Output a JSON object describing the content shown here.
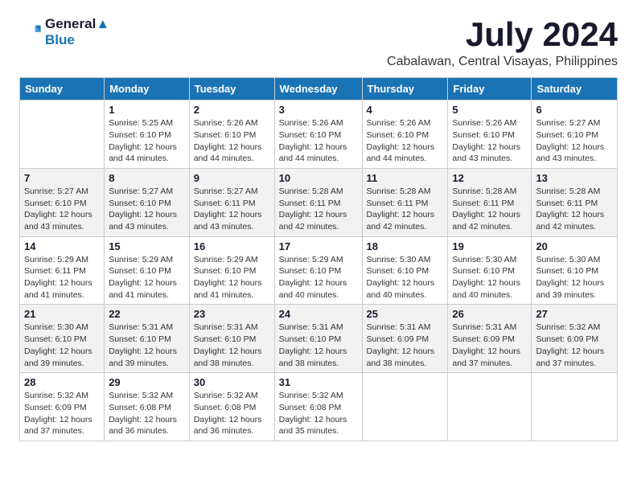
{
  "logo": {
    "line1": "General",
    "line2": "Blue"
  },
  "title": {
    "month_year": "July 2024",
    "location": "Cabalawan, Central Visayas, Philippines"
  },
  "headers": [
    "Sunday",
    "Monday",
    "Tuesday",
    "Wednesday",
    "Thursday",
    "Friday",
    "Saturday"
  ],
  "weeks": [
    [
      {
        "day": "",
        "info": ""
      },
      {
        "day": "1",
        "info": "Sunrise: 5:25 AM\nSunset: 6:10 PM\nDaylight: 12 hours\nand 44 minutes."
      },
      {
        "day": "2",
        "info": "Sunrise: 5:26 AM\nSunset: 6:10 PM\nDaylight: 12 hours\nand 44 minutes."
      },
      {
        "day": "3",
        "info": "Sunrise: 5:26 AM\nSunset: 6:10 PM\nDaylight: 12 hours\nand 44 minutes."
      },
      {
        "day": "4",
        "info": "Sunrise: 5:26 AM\nSunset: 6:10 PM\nDaylight: 12 hours\nand 44 minutes."
      },
      {
        "day": "5",
        "info": "Sunrise: 5:26 AM\nSunset: 6:10 PM\nDaylight: 12 hours\nand 43 minutes."
      },
      {
        "day": "6",
        "info": "Sunrise: 5:27 AM\nSunset: 6:10 PM\nDaylight: 12 hours\nand 43 minutes."
      }
    ],
    [
      {
        "day": "7",
        "info": "Sunrise: 5:27 AM\nSunset: 6:10 PM\nDaylight: 12 hours\nand 43 minutes."
      },
      {
        "day": "8",
        "info": "Sunrise: 5:27 AM\nSunset: 6:10 PM\nDaylight: 12 hours\nand 43 minutes."
      },
      {
        "day": "9",
        "info": "Sunrise: 5:27 AM\nSunset: 6:11 PM\nDaylight: 12 hours\nand 43 minutes."
      },
      {
        "day": "10",
        "info": "Sunrise: 5:28 AM\nSunset: 6:11 PM\nDaylight: 12 hours\nand 42 minutes."
      },
      {
        "day": "11",
        "info": "Sunrise: 5:28 AM\nSunset: 6:11 PM\nDaylight: 12 hours\nand 42 minutes."
      },
      {
        "day": "12",
        "info": "Sunrise: 5:28 AM\nSunset: 6:11 PM\nDaylight: 12 hours\nand 42 minutes."
      },
      {
        "day": "13",
        "info": "Sunrise: 5:28 AM\nSunset: 6:11 PM\nDaylight: 12 hours\nand 42 minutes."
      }
    ],
    [
      {
        "day": "14",
        "info": "Sunrise: 5:29 AM\nSunset: 6:11 PM\nDaylight: 12 hours\nand 41 minutes."
      },
      {
        "day": "15",
        "info": "Sunrise: 5:29 AM\nSunset: 6:10 PM\nDaylight: 12 hours\nand 41 minutes."
      },
      {
        "day": "16",
        "info": "Sunrise: 5:29 AM\nSunset: 6:10 PM\nDaylight: 12 hours\nand 41 minutes."
      },
      {
        "day": "17",
        "info": "Sunrise: 5:29 AM\nSunset: 6:10 PM\nDaylight: 12 hours\nand 40 minutes."
      },
      {
        "day": "18",
        "info": "Sunrise: 5:30 AM\nSunset: 6:10 PM\nDaylight: 12 hours\nand 40 minutes."
      },
      {
        "day": "19",
        "info": "Sunrise: 5:30 AM\nSunset: 6:10 PM\nDaylight: 12 hours\nand 40 minutes."
      },
      {
        "day": "20",
        "info": "Sunrise: 5:30 AM\nSunset: 6:10 PM\nDaylight: 12 hours\nand 39 minutes."
      }
    ],
    [
      {
        "day": "21",
        "info": "Sunrise: 5:30 AM\nSunset: 6:10 PM\nDaylight: 12 hours\nand 39 minutes."
      },
      {
        "day": "22",
        "info": "Sunrise: 5:31 AM\nSunset: 6:10 PM\nDaylight: 12 hours\nand 39 minutes."
      },
      {
        "day": "23",
        "info": "Sunrise: 5:31 AM\nSunset: 6:10 PM\nDaylight: 12 hours\nand 38 minutes."
      },
      {
        "day": "24",
        "info": "Sunrise: 5:31 AM\nSunset: 6:10 PM\nDaylight: 12 hours\nand 38 minutes."
      },
      {
        "day": "25",
        "info": "Sunrise: 5:31 AM\nSunset: 6:09 PM\nDaylight: 12 hours\nand 38 minutes."
      },
      {
        "day": "26",
        "info": "Sunrise: 5:31 AM\nSunset: 6:09 PM\nDaylight: 12 hours\nand 37 minutes."
      },
      {
        "day": "27",
        "info": "Sunrise: 5:32 AM\nSunset: 6:09 PM\nDaylight: 12 hours\nand 37 minutes."
      }
    ],
    [
      {
        "day": "28",
        "info": "Sunrise: 5:32 AM\nSunset: 6:09 PM\nDaylight: 12 hours\nand 37 minutes."
      },
      {
        "day": "29",
        "info": "Sunrise: 5:32 AM\nSunset: 6:08 PM\nDaylight: 12 hours\nand 36 minutes."
      },
      {
        "day": "30",
        "info": "Sunrise: 5:32 AM\nSunset: 6:08 PM\nDaylight: 12 hours\nand 36 minutes."
      },
      {
        "day": "31",
        "info": "Sunrise: 5:32 AM\nSunset: 6:08 PM\nDaylight: 12 hours\nand 35 minutes."
      },
      {
        "day": "",
        "info": ""
      },
      {
        "day": "",
        "info": ""
      },
      {
        "day": "",
        "info": ""
      }
    ]
  ]
}
